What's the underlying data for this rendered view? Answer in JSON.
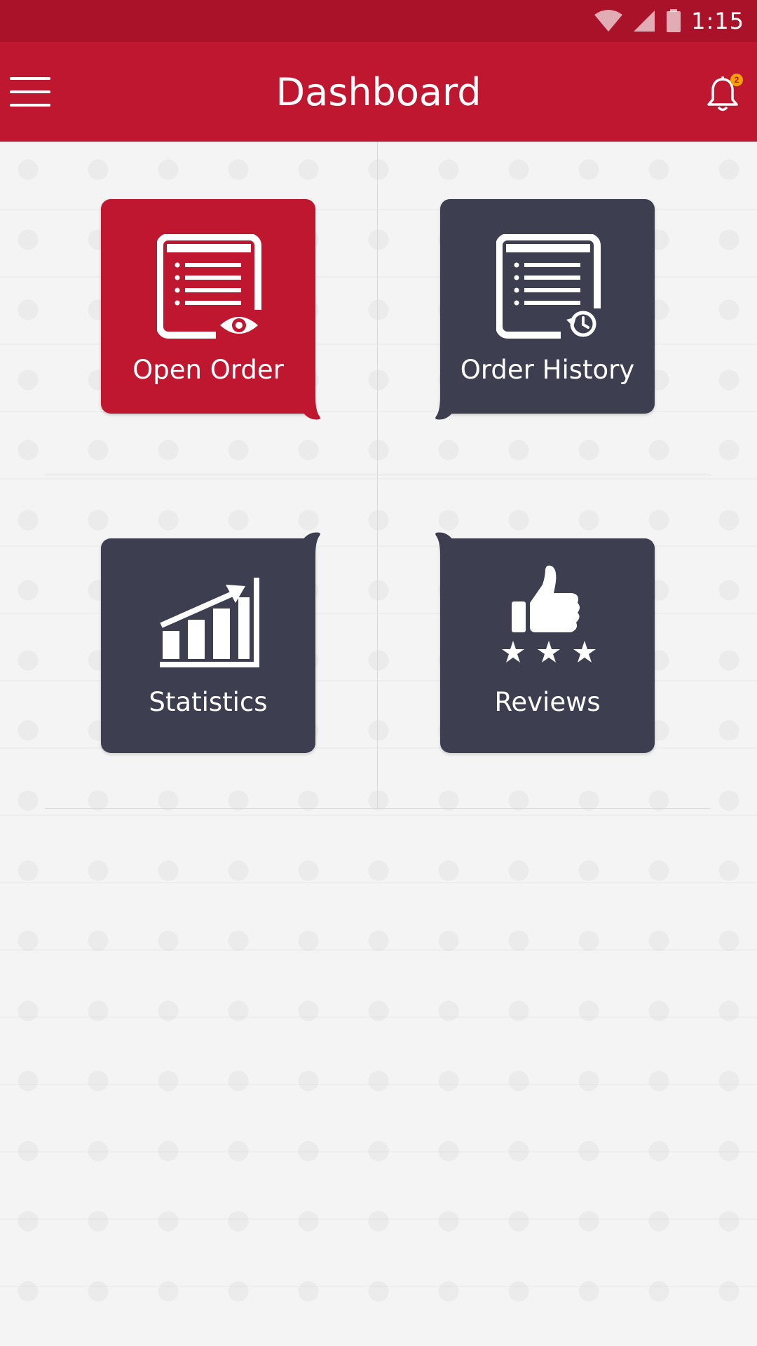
{
  "status_bar": {
    "time": "1:15",
    "icons": [
      "wifi-icon",
      "cellular-signal-icon",
      "battery-icon"
    ]
  },
  "app_bar": {
    "title": "Dashboard",
    "menu_icon": "hamburger-menu-icon",
    "notification_icon": "bell-icon",
    "notification_count": "2"
  },
  "tiles": [
    {
      "label": "Open Order",
      "icon": "document-eye-icon",
      "color": "#bf1730"
    },
    {
      "label": "Order History",
      "icon": "document-history-icon",
      "color": "#3d3f51"
    },
    {
      "label": "Statistics",
      "icon": "bar-chart-growth-icon",
      "color": "#3d3f51"
    },
    {
      "label": "Reviews",
      "icon": "thumbs-up-stars-icon",
      "color": "#3d3f51"
    }
  ],
  "colors": {
    "primary": "#bf1730",
    "primary_dark": "#a91228",
    "tile_dark": "#3d3f51",
    "badge": "#f5a20a",
    "background": "#f4f4f5"
  }
}
